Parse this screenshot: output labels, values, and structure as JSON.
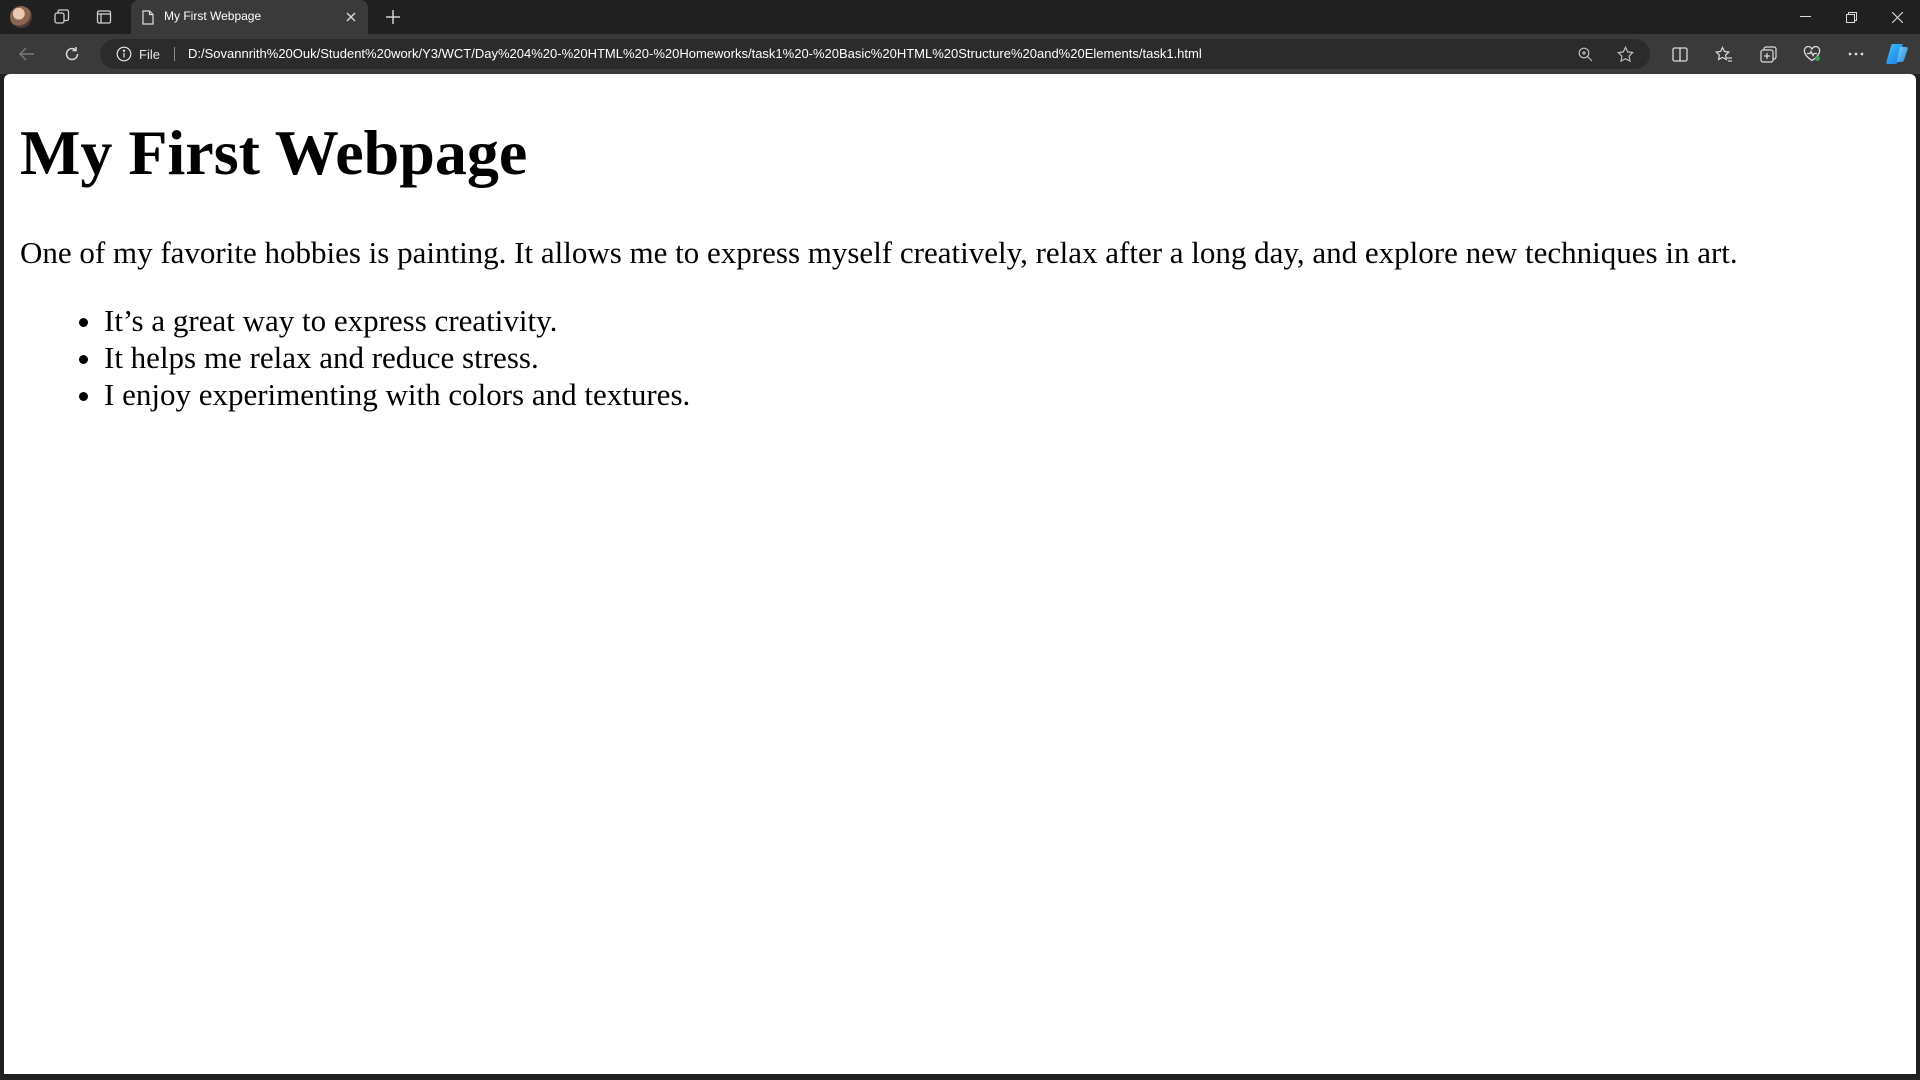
{
  "browser": {
    "tab": {
      "title": "My First Webpage",
      "icon": "page-icon"
    },
    "address": {
      "site_info_label": "File",
      "url": "D:/Sovannrith%20Ouk/Student%20work/Y3/WCT/Day%204%20-%20HTML%20-%20Homeworks/task1%20-%20Basic%20HTML%20Structure%20and%20Elements/task1.html"
    },
    "accent_color": "#0078d4",
    "tab_bg": "#3a3a3a",
    "titlebar_bg": "#202020"
  },
  "page": {
    "heading": "My First Webpage",
    "paragraph": "One of my favorite hobbies is painting. It allows me to express myself creatively, relax after a long day, and explore new techniques in art.",
    "list": [
      "It’s a great way to express creativity.",
      "It helps me relax and reduce stress.",
      "I enjoy experimenting with colors and textures."
    ]
  }
}
